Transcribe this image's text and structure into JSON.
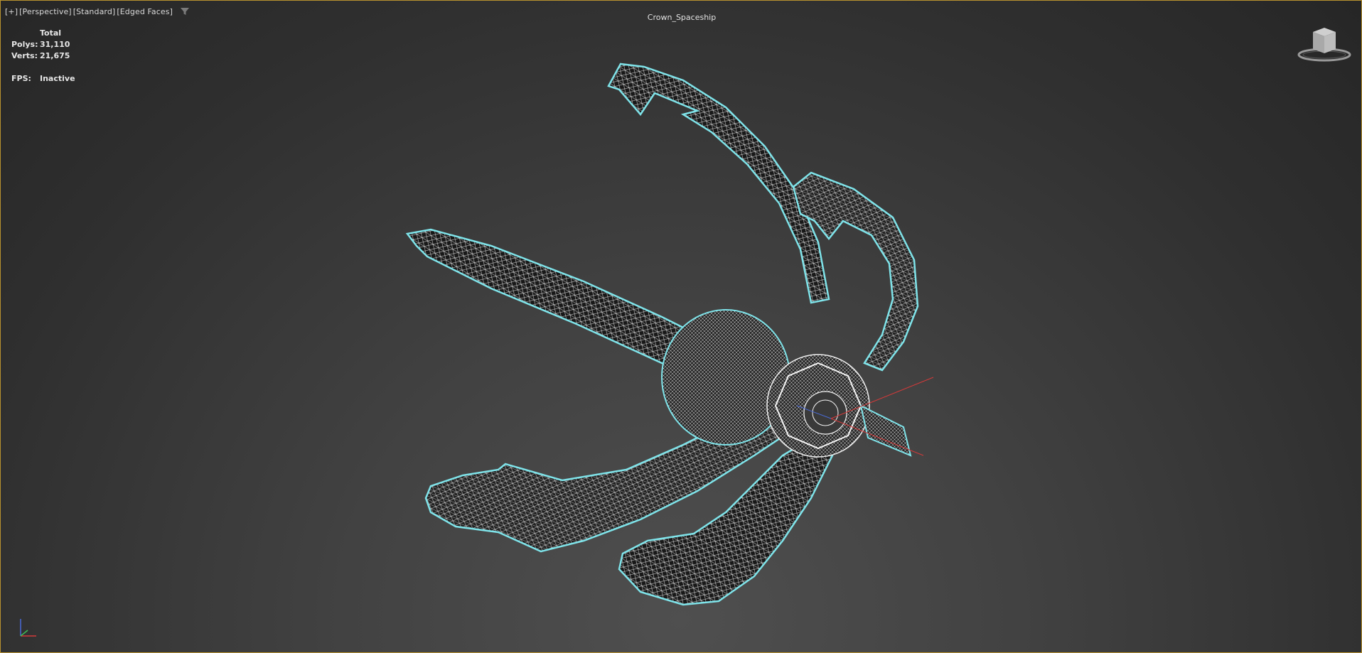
{
  "viewport": {
    "menu": {
      "plus": "[+]",
      "view": "[Perspective]",
      "shading": "[Standard]",
      "style": "[Edged Faces]",
      "filter_icon": "funnel-icon"
    },
    "object_name": "Crown_Spaceship",
    "stats": {
      "header": "Total",
      "polys_label": "Polys:",
      "polys_value": "31,110",
      "verts_label": "Verts:",
      "verts_value": "21,675",
      "fps_label": "FPS:",
      "fps_value": "Inactive"
    },
    "viewcube_icon": "viewcube-icon",
    "axis_icon": "axis-tripod-icon",
    "colors": {
      "border": "#b8922f",
      "selection_outline": "#7fe4ea",
      "wire": "#e8e8e8",
      "gizmo_x": "#d33a3a",
      "gizmo_z": "#4a6bd8"
    }
  }
}
